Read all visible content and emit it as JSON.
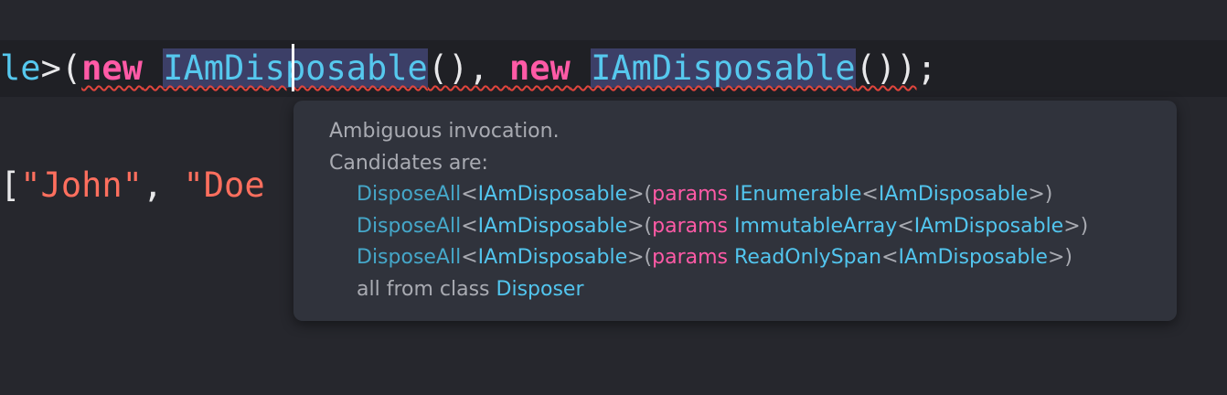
{
  "editor": {
    "line1": [
      {
        "text": "le",
        "kind": "ident"
      },
      {
        "text": ">(",
        "kind": "punct"
      },
      {
        "text": "new",
        "kind": "kw"
      },
      {
        "text": " ",
        "kind": "punct"
      },
      {
        "text": "IAmDi",
        "kind": "ident"
      },
      {
        "text": "sposable",
        "kind": "ident"
      },
      {
        "text": "(), ",
        "kind": "punct"
      },
      {
        "text": "new",
        "kind": "kw"
      },
      {
        "text": " ",
        "kind": "punct"
      },
      {
        "text": "IAmDisposable",
        "kind": "ident"
      },
      {
        "text": "())",
        "kind": "punct"
      },
      {
        "text": ";",
        "kind": "punct"
      }
    ],
    "line2": [
      {
        "text": "[",
        "kind": "punct"
      },
      {
        "text": "\"John\"",
        "kind": "str"
      },
      {
        "text": ", ",
        "kind": "punct"
      },
      {
        "text": "\"Doe",
        "kind": "str"
      }
    ]
  },
  "tooltip": {
    "message": "Ambiguous invocation.",
    "candidates_label": "Candidates are:",
    "candidates": [
      {
        "method": "DisposeAll",
        "type_arg": "IAmDisposable",
        "keyword": "params",
        "param_type": "IEnumerable",
        "param_type_arg": "IAmDisposable"
      },
      {
        "method": "DisposeAll",
        "type_arg": "IAmDisposable",
        "keyword": "params",
        "param_type": "ImmutableArray",
        "param_type_arg": "IAmDisposable"
      },
      {
        "method": "DisposeAll",
        "type_arg": "IAmDisposable",
        "keyword": "params",
        "param_type": "ReadOnlySpan",
        "param_type_arg": "IAmDisposable"
      }
    ],
    "footer_prefix": "all from class",
    "footer_class": "Disposer"
  },
  "colors": {
    "background": "#26272d",
    "current_line": "#1f2025",
    "identifier": "#56c8ee",
    "keyword": "#ff5aa6",
    "string": "#ff6f5e",
    "selection_highlight": "#3c3f67",
    "error_squiggle": "#e0453d",
    "tooltip_background": "#30333c"
  }
}
